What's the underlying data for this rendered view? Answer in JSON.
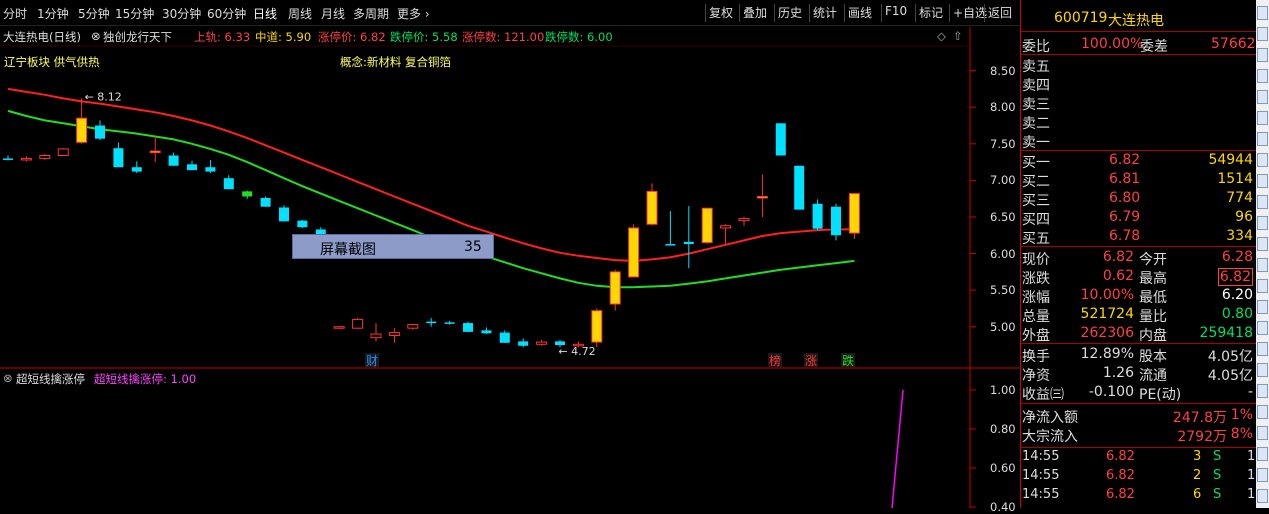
{
  "topbar": {
    "tabs": [
      "分时",
      "1分钟",
      "5分钟",
      "15分钟",
      "30分钟",
      "60分钟",
      "日线",
      "周线",
      "月线",
      "多周期",
      "更多 ›"
    ],
    "buttons": [
      "复权",
      "叠加",
      "历史",
      "统计",
      "画线",
      "F10",
      "标记",
      "+自选",
      "返回"
    ]
  },
  "info": {
    "title": "大连热电(日线)",
    "indicator": "独创龙行天下",
    "upper": "上轨: 6.33",
    "middle": "中道: 5.90",
    "limit_up": "涨停价: 6.82",
    "limit_down": "跌停价: 5.58",
    "up_count": "涨停数: 121.00",
    "down_count": "跌停数: 6.00"
  },
  "notes": {
    "board": "辽宁板块 供气供热",
    "concept": "概念:新材料 复合铜箔"
  },
  "price_axis": [
    "8.50",
    "8.00",
    "7.50",
    "7.00",
    "6.50",
    "6.00",
    "5.50",
    "5.00"
  ],
  "annotations": {
    "high": "8.12",
    "low": "4.72",
    "cai": "财",
    "bang": "榜",
    "zhang": "涨",
    "die": "跌"
  },
  "overlay": {
    "label": "屏幕截图",
    "count": "35"
  },
  "indicator_panel": {
    "name": "超短线擒涨停",
    "series_label": "超短线擒涨停: 1.00",
    "axis": [
      "1.00",
      "0.80",
      "0.60",
      "0.40"
    ]
  },
  "quote": {
    "code": "600719",
    "name": "大连热电",
    "weibi_label": "委比",
    "weibi": "100.00%",
    "weicha_label": "委差",
    "weicha": "57662",
    "sells": [
      {
        "label": "卖五"
      },
      {
        "label": "卖四"
      },
      {
        "label": "卖三"
      },
      {
        "label": "卖二"
      },
      {
        "label": "卖一"
      }
    ],
    "buys": [
      {
        "label": "买一",
        "price": "6.82",
        "vol": "54944"
      },
      {
        "label": "买二",
        "price": "6.81",
        "vol": "1514"
      },
      {
        "label": "买三",
        "price": "6.80",
        "vol": "774"
      },
      {
        "label": "买四",
        "price": "6.79",
        "vol": "96"
      },
      {
        "label": "买五",
        "price": "6.78",
        "vol": "334"
      }
    ],
    "stats": [
      {
        "l1": "现价",
        "v1": "6.82",
        "l2": "今开",
        "v2": "6.28"
      },
      {
        "l1": "涨跌",
        "v1": "0.62",
        "l2": "最高",
        "v2": "6.82"
      },
      {
        "l1": "涨幅",
        "v1": "10.00%",
        "l2": "最低",
        "v2": "6.20"
      },
      {
        "l1": "总量",
        "v1": "521724",
        "l2": "量比",
        "v2": "0.80"
      },
      {
        "l1": "外盘",
        "v1": "262306",
        "l2": "内盘",
        "v2": "259418"
      }
    ],
    "stats2": [
      {
        "l1": "换手",
        "v1": "12.89%",
        "l2": "股本",
        "v2": "4.05亿"
      },
      {
        "l1": "净资",
        "v1": "1.26",
        "l2": "流通",
        "v2": "4.05亿"
      },
      {
        "l1": "收益㈢",
        "v1": "-0.100",
        "l2": "PE(动)",
        "v2": "-"
      }
    ],
    "flow": [
      {
        "l": "净流入额",
        "v": "247.8万",
        "p": "1%"
      },
      {
        "l": "大宗流入",
        "v": "2792万",
        "p": "8%"
      }
    ],
    "ticks": [
      {
        "t": "14:55",
        "p": "6.82",
        "v": "3",
        "s": "S",
        "n": "1"
      },
      {
        "t": "14:55",
        "p": "6.82",
        "v": "2",
        "s": "S",
        "n": "1"
      },
      {
        "t": "14:55",
        "p": "6.82",
        "v": "6",
        "s": "S",
        "n": "1"
      }
    ]
  },
  "colors": {
    "up": "#ff3232",
    "down": "#00e0ff",
    "limit": "#ffd700",
    "ma_red": "#ff2020",
    "ma_green": "#22dd22",
    "magenta": "#ff00ff"
  },
  "chart_data": {
    "type": "candlestick",
    "ylim": [
      4.6,
      8.7
    ],
    "candles": [
      [
        7.3,
        7.34,
        7.27,
        7.28
      ],
      [
        7.28,
        7.33,
        7.26,
        7.3
      ],
      [
        7.3,
        7.36,
        7.28,
        7.34
      ],
      [
        7.34,
        7.44,
        7.33,
        7.43
      ],
      [
        7.52,
        8.12,
        7.5,
        7.85
      ],
      [
        7.75,
        7.82,
        7.55,
        7.57
      ],
      [
        7.44,
        7.52,
        7.18,
        7.18
      ],
      [
        7.18,
        7.26,
        7.1,
        7.12
      ],
      [
        7.4,
        7.6,
        7.25,
        7.4
      ],
      [
        7.34,
        7.38,
        7.2,
        7.2
      ],
      [
        7.22,
        7.27,
        7.14,
        7.14
      ],
      [
        7.18,
        7.28,
        7.1,
        7.12
      ],
      [
        7.03,
        7.07,
        6.88,
        6.88
      ],
      [
        6.85,
        6.86,
        6.75,
        6.78
      ],
      [
        6.76,
        6.78,
        6.64,
        6.64
      ],
      [
        6.63,
        6.66,
        6.44,
        6.44
      ],
      [
        6.45,
        6.46,
        6.35,
        6.36
      ],
      [
        6.33,
        6.36,
        6.18,
        6.18
      ],
      [
        4.98,
        5.01,
        4.97,
        5.0
      ],
      [
        4.98,
        5.12,
        4.97,
        5.1
      ],
      [
        4.85,
        5.05,
        4.8,
        4.9
      ],
      [
        4.88,
        4.98,
        4.78,
        4.92
      ],
      [
        4.98,
        5.04,
        4.96,
        5.03
      ],
      [
        5.07,
        5.12,
        5.0,
        5.05
      ],
      [
        5.06,
        5.08,
        5.03,
        5.05
      ],
      [
        5.05,
        5.07,
        4.93,
        4.93
      ],
      [
        4.95,
        4.99,
        4.9,
        4.91
      ],
      [
        4.92,
        4.95,
        4.78,
        4.78
      ],
      [
        4.8,
        4.84,
        4.72,
        4.74
      ],
      [
        4.76,
        4.82,
        4.74,
        4.79
      ],
      [
        4.8,
        4.82,
        4.72,
        4.75
      ],
      [
        4.76,
        4.8,
        4.72,
        4.76
      ],
      [
        4.79,
        5.25,
        4.72,
        5.22
      ],
      [
        5.31,
        5.78,
        5.22,
        5.75
      ],
      [
        5.68,
        6.4,
        5.68,
        6.35
      ],
      [
        6.4,
        6.96,
        6.38,
        6.85
      ],
      [
        6.13,
        6.58,
        6.12,
        6.12
      ],
      [
        6.16,
        6.65,
        5.8,
        6.13
      ],
      [
        6.15,
        6.62,
        6.13,
        6.62
      ],
      [
        6.35,
        6.4,
        6.13,
        6.38
      ],
      [
        6.45,
        6.5,
        6.38,
        6.48
      ],
      [
        6.78,
        7.08,
        6.5,
        6.78
      ],
      [
        7.78,
        7.78,
        7.35,
        7.34
      ],
      [
        7.2,
        7.2,
        6.65,
        6.6
      ],
      [
        6.68,
        6.74,
        6.32,
        6.34
      ],
      [
        6.64,
        6.68,
        6.18,
        6.25
      ],
      [
        6.28,
        6.82,
        6.2,
        6.82
      ]
    ],
    "ma_red": [
      8.25,
      8.21,
      8.17,
      8.12,
      8.08,
      8.05,
      8.01,
      7.97,
      7.93,
      7.88,
      7.82,
      7.75,
      7.67,
      7.58,
      7.48,
      7.38,
      7.28,
      7.18,
      7.08,
      6.98,
      6.88,
      6.78,
      6.68,
      6.58,
      6.48,
      6.38,
      6.3,
      6.22,
      6.14,
      6.07,
      6.01,
      5.97,
      5.94,
      5.91,
      5.9,
      5.92,
      5.95,
      6.0,
      6.06,
      6.12,
      6.18,
      6.24,
      6.28,
      6.3,
      6.32,
      6.33,
      6.33
    ],
    "ma_green": [
      7.95,
      7.88,
      7.82,
      7.78,
      7.74,
      7.7,
      7.67,
      7.64,
      7.6,
      7.56,
      7.5,
      7.43,
      7.35,
      7.25,
      7.14,
      7.03,
      6.92,
      6.82,
      6.72,
      6.62,
      6.52,
      6.42,
      6.32,
      6.22,
      6.13,
      6.04,
      5.96,
      5.88,
      5.8,
      5.73,
      5.66,
      5.6,
      5.56,
      5.54,
      5.54,
      5.55,
      5.56,
      5.59,
      5.62,
      5.66,
      5.7,
      5.74,
      5.78,
      5.81,
      5.84,
      5.87,
      5.9
    ],
    "indicator": [
      0,
      0,
      0,
      0,
      0,
      0,
      0,
      0,
      0,
      0,
      0,
      0,
      0,
      0,
      0,
      0,
      0,
      0,
      0,
      0,
      0,
      0,
      0,
      0,
      0,
      0,
      0,
      0,
      0,
      0,
      0,
      0,
      0,
      0,
      0,
      0,
      0,
      0,
      0,
      0,
      0,
      0,
      0,
      0,
      0,
      0,
      1.0
    ]
  }
}
